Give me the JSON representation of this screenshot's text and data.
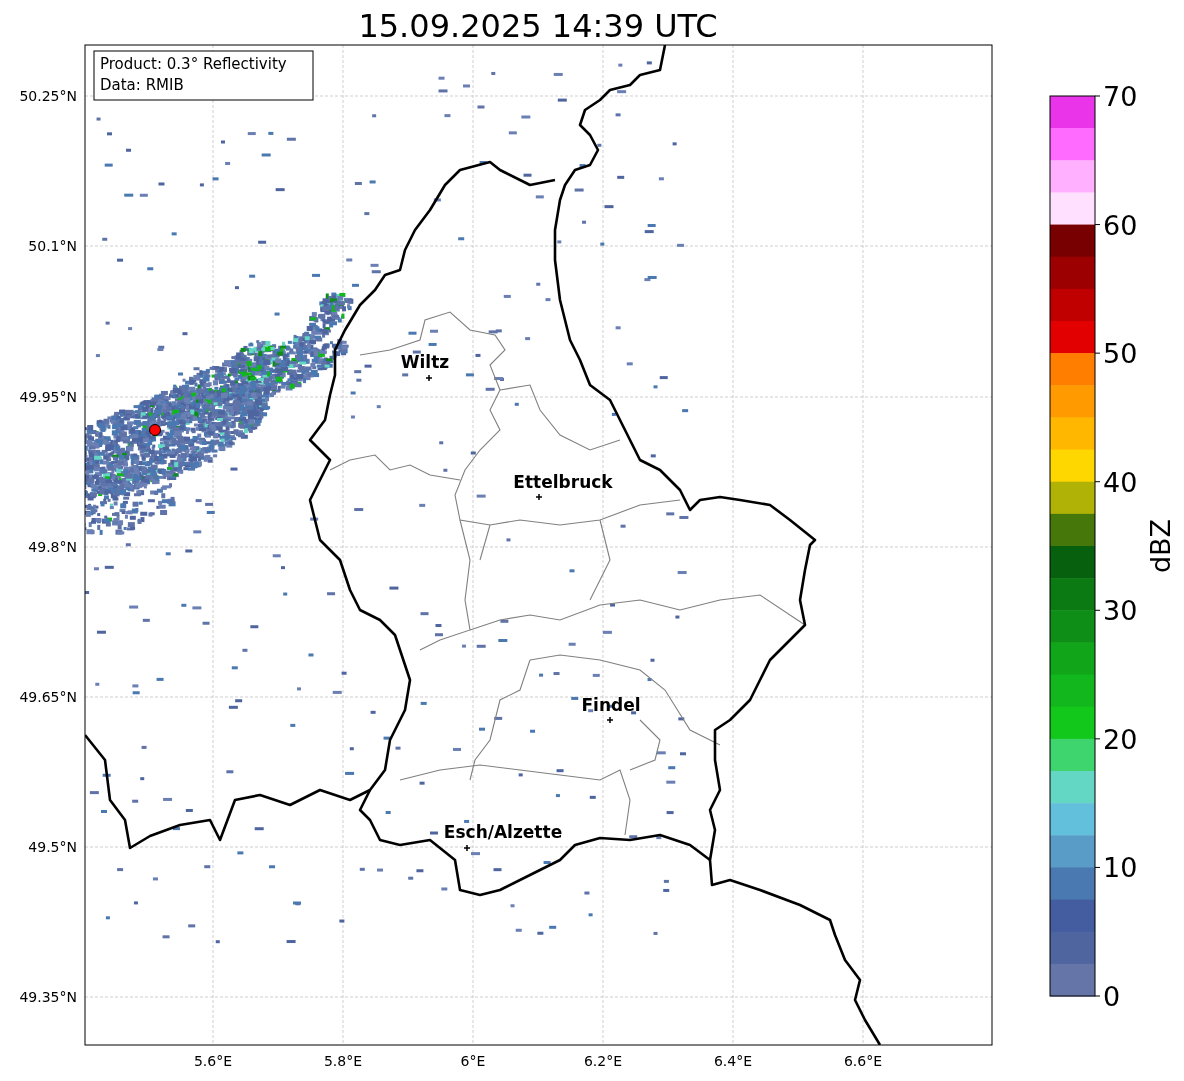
{
  "title": "15.09.2025 14:39 UTC",
  "info": [
    "Product: 0.3° Reflectivity",
    "Data: RMIB"
  ],
  "map": {
    "echo": {
      "kind": "picture"
    },
    "lat_labels": [
      "50.25°N",
      "50.1°N",
      "49.95°N",
      "49.8°N",
      "49.65°N",
      "49.5°N",
      "49.35°N"
    ],
    "lon_labels": [
      "5.6°E",
      "5.8°E",
      "6°E",
      "6.2°E",
      "6.4°E",
      "6.6°E"
    ],
    "cities": [
      {
        "name": "Wiltz"
      },
      {
        "name": "Ettelbruck"
      },
      {
        "name": "Findel"
      },
      {
        "name": "Esch/Alzette"
      }
    ]
  },
  "colorbar": {
    "label": "dBZ",
    "ticks": [
      "70",
      "60",
      "50",
      "40",
      "30",
      "20",
      "10",
      "0"
    ],
    "segments": [
      {
        "color": "#ea34ea"
      },
      {
        "color": "#ff6aff"
      },
      {
        "color": "#ffb0ff"
      },
      {
        "color": "#ffe0ff"
      },
      {
        "color": "#780000"
      },
      {
        "color": "#9c0000"
      },
      {
        "color": "#c00000"
      },
      {
        "color": "#e30000"
      },
      {
        "color": "#ff7e00"
      },
      {
        "color": "#ff9a00"
      },
      {
        "color": "#ffb700"
      },
      {
        "color": "#ffd700"
      },
      {
        "color": "#b0b306"
      },
      {
        "color": "#45770a"
      },
      {
        "color": "#06600e"
      },
      {
        "color": "#0b7a12"
      },
      {
        "color": "#0e8e17"
      },
      {
        "color": "#11a51a"
      },
      {
        "color": "#12b71d"
      },
      {
        "color": "#12c91b"
      },
      {
        "color": "#3ed46e"
      },
      {
        "color": "#63d6c4"
      },
      {
        "color": "#63c0dc"
      },
      {
        "color": "#5a9cc8"
      },
      {
        "color": "#4a78b0"
      },
      {
        "color": "#435da0"
      },
      {
        "color": "#4f65a0"
      },
      {
        "color": "#6675a8"
      }
    ]
  }
}
